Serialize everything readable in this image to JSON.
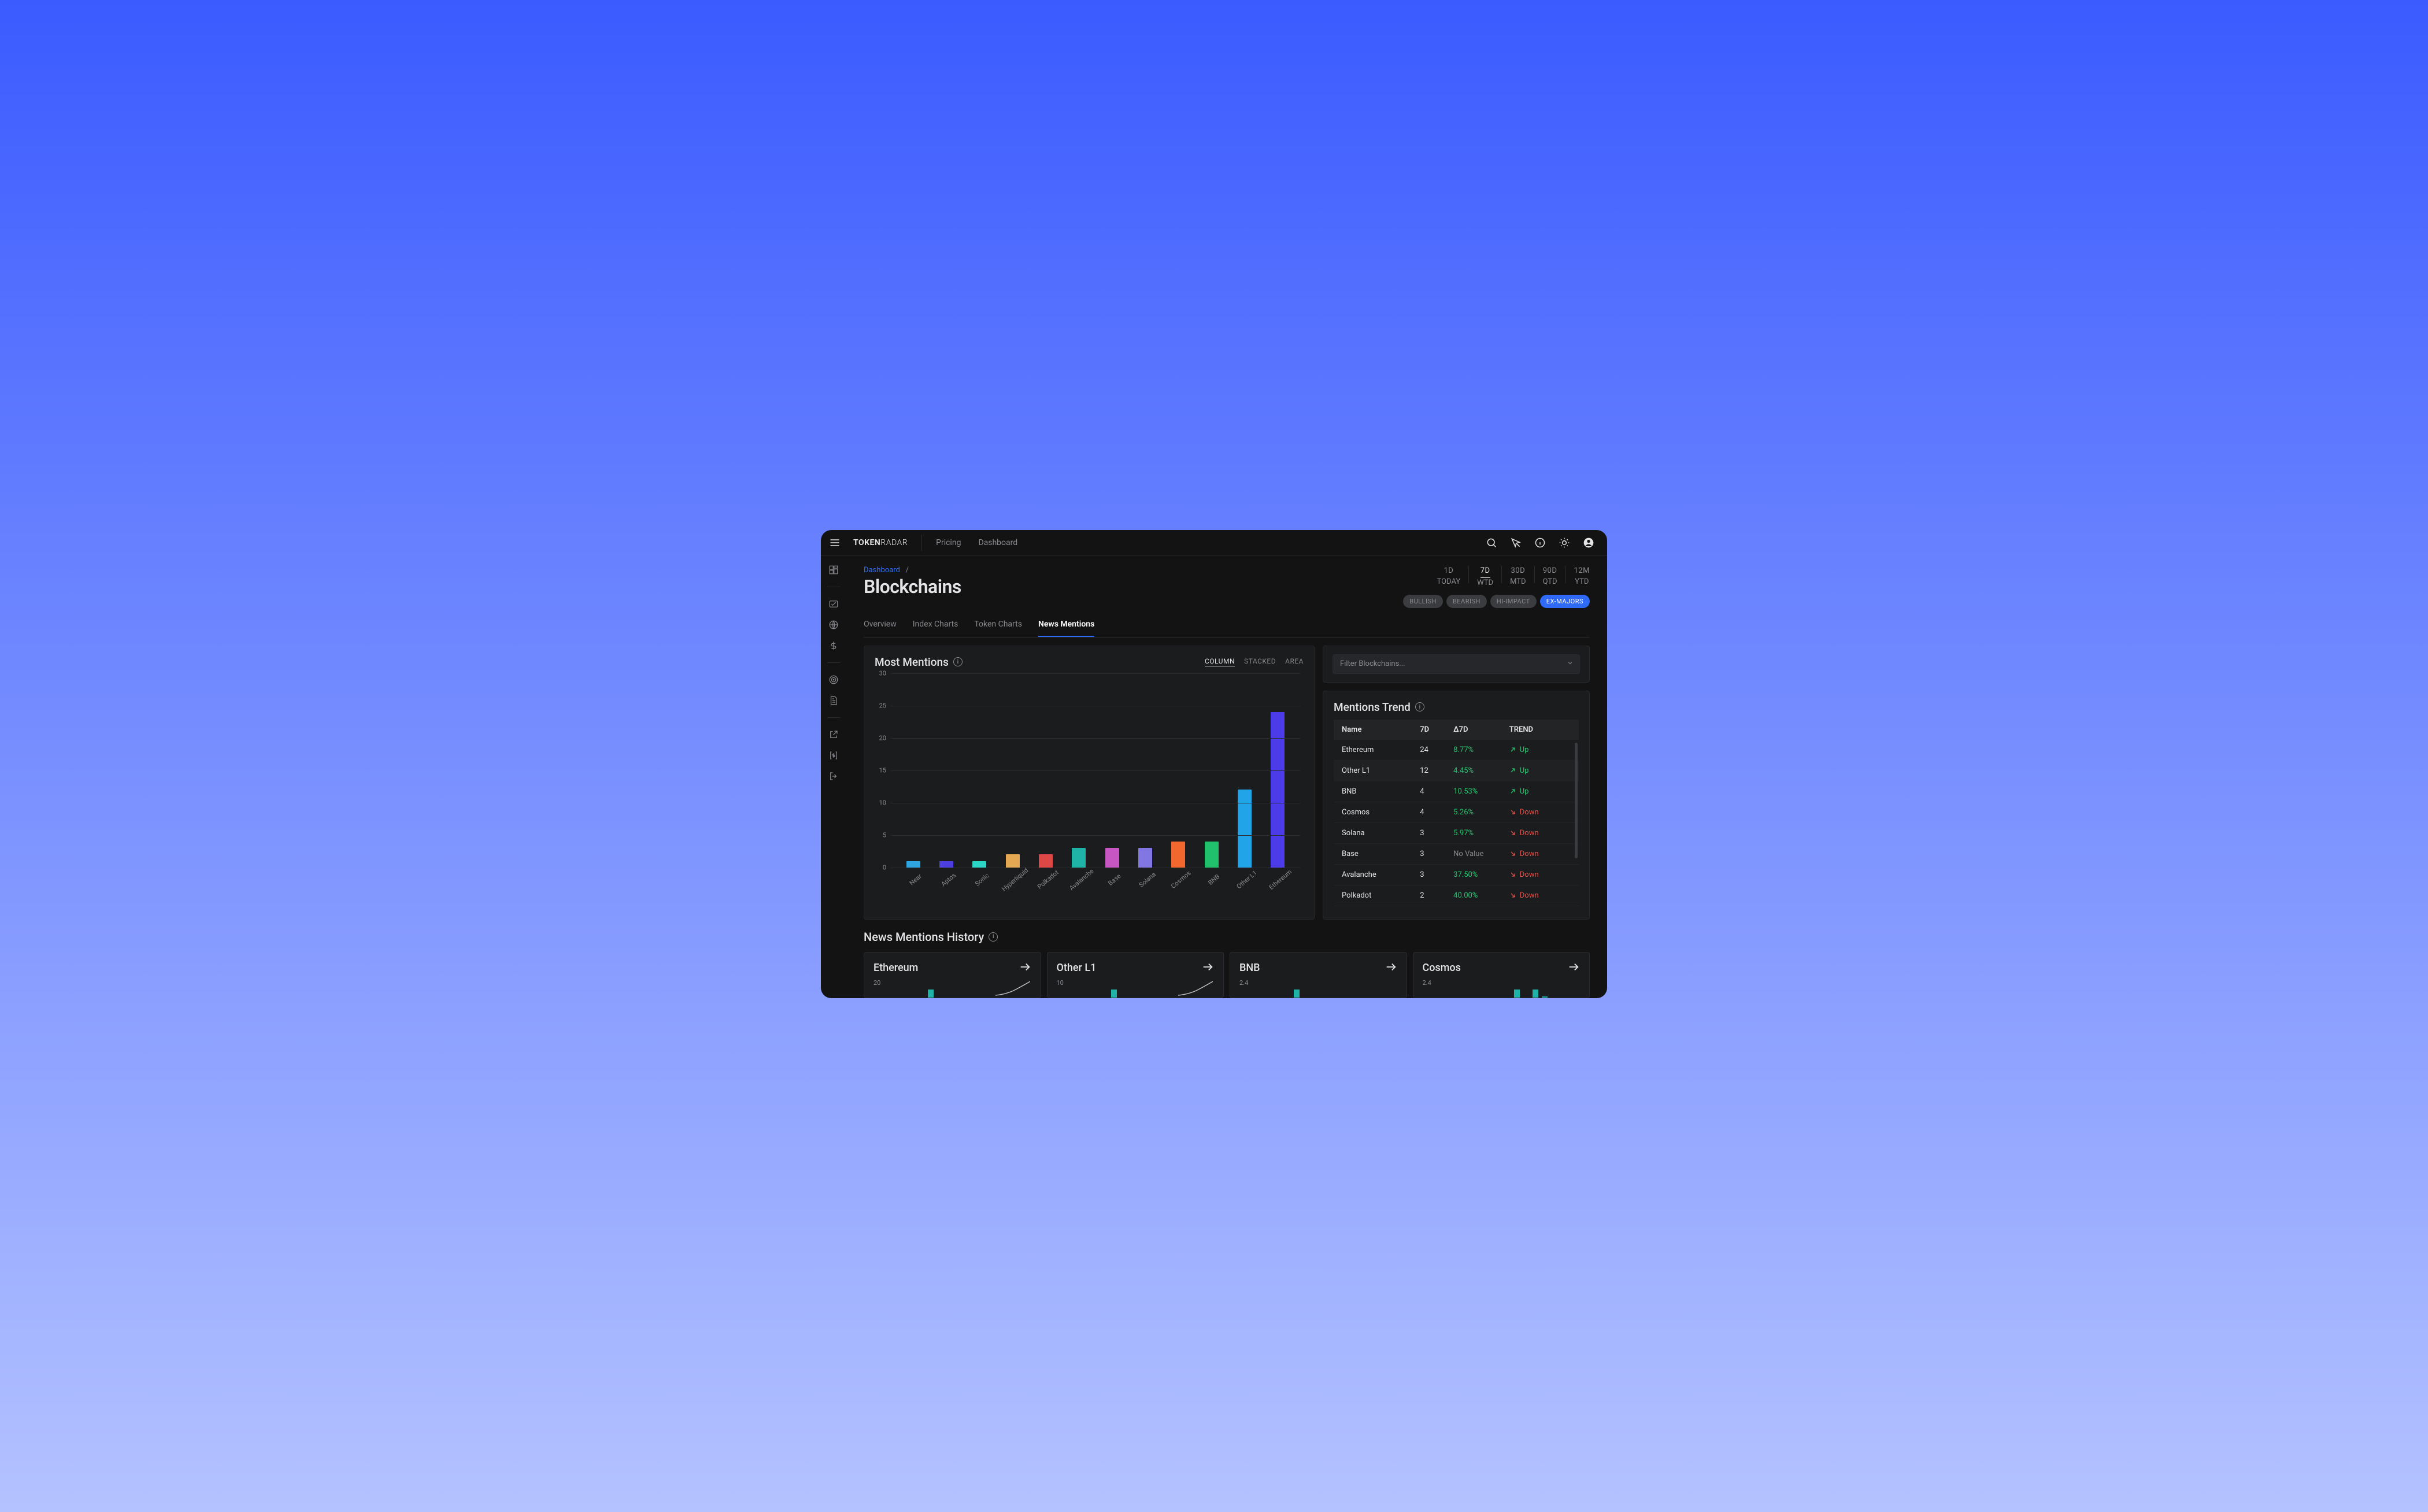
{
  "logo": {
    "part1": "TOKEN",
    "part2": "RADAR"
  },
  "topnav": {
    "pricing": "Pricing",
    "dashboard": "Dashboard"
  },
  "breadcrumb": {
    "root": "Dashboard",
    "sep": "/"
  },
  "page_title": "Blockchains",
  "periods": [
    {
      "top": "1D",
      "bot": "TODAY"
    },
    {
      "top": "7D",
      "bot": "WTD",
      "active": true
    },
    {
      "top": "30D",
      "bot": "MTD"
    },
    {
      "top": "90D",
      "bot": "QTD"
    },
    {
      "top": "12M",
      "bot": "YTD"
    }
  ],
  "chips": [
    {
      "label": "BULLISH"
    },
    {
      "label": "BEARISH"
    },
    {
      "label": "HI-IMPACT"
    },
    {
      "label": "EX-MAJORS",
      "active": true
    }
  ],
  "tabs": [
    {
      "label": "Overview"
    },
    {
      "label": "Index Charts"
    },
    {
      "label": "Token Charts"
    },
    {
      "label": "News Mentions",
      "active": true
    }
  ],
  "filter_placeholder": "Filter Blockchains...",
  "chart": {
    "title": "Most Mentions",
    "modes": {
      "column": "COLUMN",
      "stacked": "STACKED",
      "area": "AREA"
    }
  },
  "chart_data": {
    "type": "bar",
    "title": "Most Mentions",
    "xlabel": "",
    "ylabel": "",
    "ylim": [
      0,
      30
    ],
    "yticks": [
      0,
      5,
      10,
      15,
      20,
      25,
      30
    ],
    "categories": [
      "Near",
      "Aptos",
      "Sonic",
      "Hyperliquid",
      "Polkadot",
      "Avalanche",
      "Base",
      "Solana",
      "Cosmos",
      "BNB",
      "Other L1",
      "Ethereum"
    ],
    "values": [
      1,
      1,
      1,
      2,
      2,
      3,
      3,
      3,
      4,
      4,
      12,
      24
    ],
    "colors": [
      "#2ea4e0",
      "#4e3fe0",
      "#2bd6c6",
      "#e5a852",
      "#dd4846",
      "#1fb3a8",
      "#c755c2",
      "#8176e2",
      "#f2672d",
      "#21c06a",
      "#22a5e8",
      "#4c3be8"
    ]
  },
  "trend": {
    "title": "Mentions Trend",
    "cols": {
      "name": "Name",
      "d7": "7D",
      "delta": "Δ7D",
      "trend": "TREND"
    },
    "rows": [
      {
        "name": "Ethereum",
        "d7": "24",
        "delta": "8.77%",
        "trend": "Up"
      },
      {
        "name": "Other L1",
        "d7": "12",
        "delta": "4.45%",
        "trend": "Up"
      },
      {
        "name": "BNB",
        "d7": "4",
        "delta": "10.53%",
        "trend": "Up"
      },
      {
        "name": "Cosmos",
        "d7": "4",
        "delta": "5.26%",
        "trend": "Down"
      },
      {
        "name": "Solana",
        "d7": "3",
        "delta": "5.97%",
        "trend": "Down"
      },
      {
        "name": "Base",
        "d7": "3",
        "delta": "No Value",
        "trend": "Down",
        "na": true
      },
      {
        "name": "Avalanche",
        "d7": "3",
        "delta": "37.50%",
        "trend": "Down"
      },
      {
        "name": "Polkadot",
        "d7": "2",
        "delta": "40.00%",
        "trend": "Down"
      }
    ]
  },
  "history": {
    "title": "News Mentions History",
    "cards": [
      {
        "title": "Ethereum",
        "y": "20"
      },
      {
        "title": "Other L1",
        "y": "10"
      },
      {
        "title": "BNB",
        "y": "2.4"
      },
      {
        "title": "Cosmos",
        "y": "2.4"
      }
    ]
  }
}
